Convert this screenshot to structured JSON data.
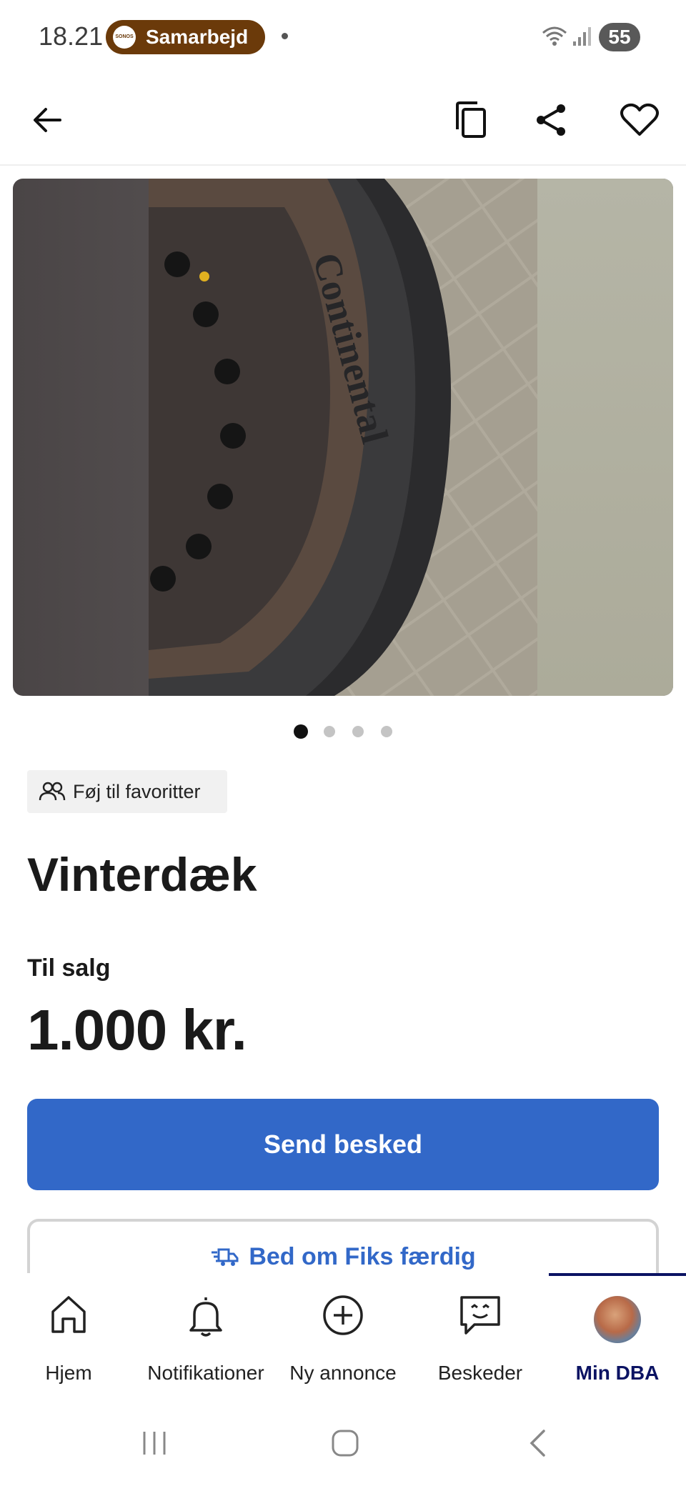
{
  "status_bar": {
    "time": "18.21",
    "notification_app": "Samarbejd",
    "notification_logo": "SONOS",
    "battery": "55"
  },
  "app_bar": {
    "icons": [
      "back-arrow-icon",
      "copy-icon",
      "share-icon",
      "heart-icon"
    ]
  },
  "gallery": {
    "image_count": 4,
    "active_index": 0
  },
  "listing": {
    "favorite_chip_label": "Føj til favoritter",
    "title": "Vinterdæk",
    "sale_type": "Til salg",
    "price": "1.000 kr."
  },
  "actions": {
    "send_message_label": "Send besked",
    "fiks_label": "Bed om Fiks færdig"
  },
  "bottom_nav": {
    "items": [
      {
        "label": "Hjem",
        "icon": "home-icon"
      },
      {
        "label": "Notifikationer",
        "icon": "bell-icon"
      },
      {
        "label": "Ny annonce",
        "icon": "plus-circle-icon"
      },
      {
        "label": "Beskeder",
        "icon": "chat-icon"
      },
      {
        "label": "Min DBA",
        "icon": "avatar"
      }
    ],
    "active_index": 4
  },
  "colors": {
    "accent": "#3268c8",
    "nav_active": "#0b1363",
    "notification_pill": "#6b3a0a"
  }
}
